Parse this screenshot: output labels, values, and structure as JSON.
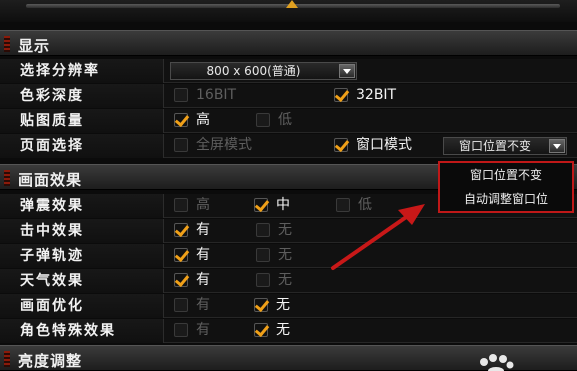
{
  "sections": {
    "display": "显示",
    "effects": "画面效果",
    "brightness": "亮度调整"
  },
  "rows": {
    "resolution": {
      "label": "选择分辨率",
      "value": "800 x 600(普通)"
    },
    "color_depth": {
      "label": "色彩深度",
      "opt1": "16BIT",
      "opt2": "32BIT",
      "selected": "32BIT"
    },
    "texture_quality": {
      "label": "贴图质量",
      "opt1": "高",
      "opt2": "低",
      "selected": "高"
    },
    "page_select": {
      "label": "页面选择",
      "opt1": "全屏模式",
      "opt2": "窗口模式",
      "selected": "窗口模式",
      "window_value": "窗口位置不变"
    },
    "shake": {
      "label": "弹震效果",
      "opt1": "高",
      "opt2": "中",
      "opt3": "低",
      "selected": "中"
    },
    "hit": {
      "label": "击中效果",
      "opt1": "有",
      "opt2": "无",
      "selected": "有"
    },
    "trail": {
      "label": "子弹轨迹",
      "opt1": "有",
      "opt2": "无",
      "selected": "有"
    },
    "weather": {
      "label": "天气效果",
      "opt1": "有",
      "opt2": "无",
      "selected": "有"
    },
    "optimize": {
      "label": "画面优化",
      "opt1": "有",
      "opt2": "无",
      "selected": "无"
    },
    "special": {
      "label": "角色特殊效果",
      "opt1": "有",
      "opt2": "无",
      "selected": "无"
    }
  },
  "dropdown": {
    "items": [
      "窗口位置不变",
      "自动调整窗口位"
    ]
  },
  "colors": {
    "accent": "#f0a018",
    "highlight_border": "#c01818",
    "annotation_arrow": "#c81818"
  },
  "icons": {
    "checkbox_check": "checkmark-icon",
    "select_arrow": "chevron-down-icon",
    "paw": "paw-icon"
  }
}
